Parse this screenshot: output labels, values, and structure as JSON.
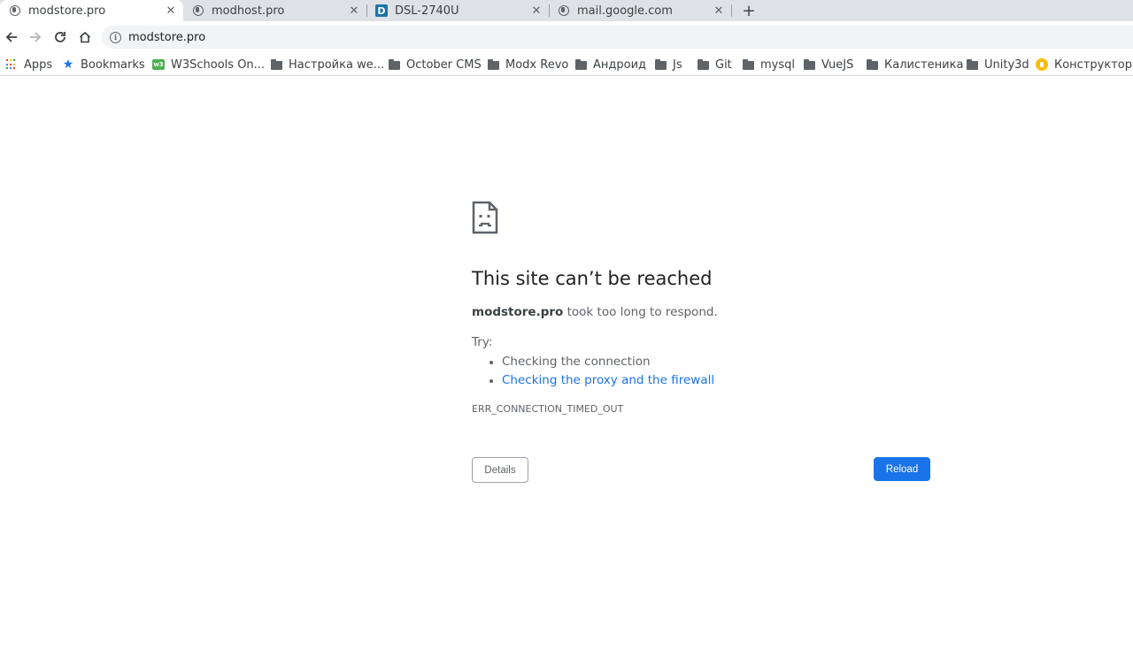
{
  "tabs": [
    {
      "title": "modstore.pro",
      "icon": "globe-icon",
      "active": true
    },
    {
      "title": "modhost.pro",
      "icon": "globe-icon",
      "active": false
    },
    {
      "title": "DSL-2740U",
      "icon": "d-link-icon",
      "icon_letter": "D",
      "active": false
    },
    {
      "title": "mail.google.com",
      "icon": "globe-icon",
      "active": false
    }
  ],
  "tab_close_glyph": "✕",
  "new_tab_glyph": "+",
  "toolbar": {
    "url": "modstore.pro",
    "info_glyph": "i"
  },
  "bookmarks": [
    {
      "label": "Apps",
      "icon": "apps-grid-icon"
    },
    {
      "label": "Bookmarks",
      "icon": "star-icon"
    },
    {
      "label": "W3Schools On...",
      "icon": "w3schools-icon"
    },
    {
      "label": "Настройка we...",
      "icon": "folder-icon"
    },
    {
      "label": "October CMS",
      "icon": "folder-icon"
    },
    {
      "label": "Modx Revo",
      "icon": "folder-icon"
    },
    {
      "label": "Андроид",
      "icon": "folder-icon"
    },
    {
      "label": "Js",
      "icon": "folder-icon"
    },
    {
      "label": "Git",
      "icon": "folder-icon"
    },
    {
      "label": "mysql",
      "icon": "folder-icon"
    },
    {
      "label": "VueJS",
      "icon": "folder-icon"
    },
    {
      "label": "Калистеника",
      "icon": "folder-icon"
    },
    {
      "label": "Unity3d",
      "icon": "folder-icon"
    },
    {
      "label": "Конструктор...",
      "icon": "yandex-constructor-icon"
    }
  ],
  "error": {
    "heading": "This site can’t be reached",
    "host": "modstore.pro",
    "summary_rest": " took too long to respond.",
    "try_label": "Try:",
    "suggestions": [
      {
        "text": "Checking the connection",
        "link": false
      },
      {
        "text": "Checking the proxy and the firewall",
        "link": true
      }
    ],
    "code": "ERR_CONNECTION_TIMED_OUT",
    "details_label": "Details",
    "reload_label": "Reload"
  },
  "colors": {
    "accent": "#1a73e8",
    "tabstrip": "#dee1e6",
    "text_secondary": "#5f6368"
  }
}
